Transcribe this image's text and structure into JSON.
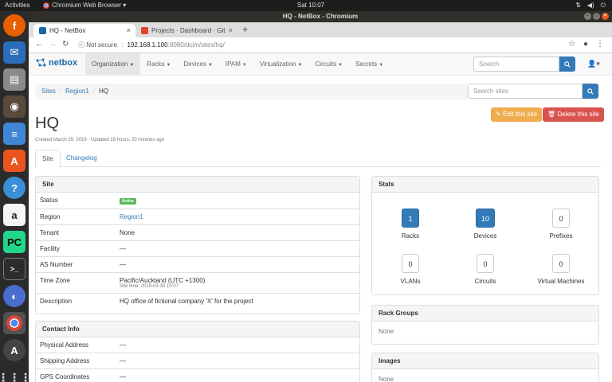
{
  "topbar": {
    "activities": "Activities",
    "app": "Chromium Web Browser ▾",
    "clock": "Sat 10:07"
  },
  "window": {
    "title": "HQ - NetBox - Chromium"
  },
  "browser": {
    "tabs": [
      {
        "label": "HQ - NetBox"
      },
      {
        "label": "Projects · Dashboard · Git"
      }
    ],
    "url_security": "Not secure",
    "url_host": "192.168.1.100",
    "url_path": ":8080/dcim/sites/hq/"
  },
  "navbar": {
    "brand": "netbox",
    "items": [
      {
        "label": "Organization"
      },
      {
        "label": "Racks"
      },
      {
        "label": "Devices"
      },
      {
        "label": "IPAM"
      },
      {
        "label": "Virtualization"
      },
      {
        "label": "Circuits"
      },
      {
        "label": "Secrets"
      }
    ],
    "search_placeholder": "Search"
  },
  "breadcrumb": {
    "items": [
      "Sites",
      "Region1",
      "HQ"
    ],
    "search_placeholder": "Search sites"
  },
  "actions": {
    "edit": "Edit this site",
    "delete": "Delete this site"
  },
  "page": {
    "title": "HQ",
    "meta": "Created March 29, 2019 · Updated 18 hours, 20 minutes ago"
  },
  "tabs": [
    "Site",
    "Changelog"
  ],
  "site_panel": {
    "title": "Site",
    "rows": [
      {
        "key": "Status",
        "value": "Active"
      },
      {
        "key": "Region",
        "value": "Region1"
      },
      {
        "key": "Tenant",
        "value": "None"
      },
      {
        "key": "Facility",
        "value": "—"
      },
      {
        "key": "AS Number",
        "value": "—"
      },
      {
        "key": "Time Zone",
        "value": "Pacific/Auckland (UTC +1300)",
        "sub": "Site time: 2019-03-30 10:07"
      },
      {
        "key": "Description",
        "value": "HQ office of fictional company 'X' for the project"
      }
    ]
  },
  "contact_panel": {
    "title": "Contact Info",
    "rows": [
      {
        "key": "Physical Address",
        "value": "—"
      },
      {
        "key": "Shipping Address",
        "value": "—"
      },
      {
        "key": "GPS Coordinates",
        "value": "—"
      }
    ]
  },
  "stats_panel": {
    "title": "Stats",
    "items": [
      {
        "value": "1",
        "label": "Racks"
      },
      {
        "value": "10",
        "label": "Devices"
      },
      {
        "value": "0",
        "label": "Prefixes"
      },
      {
        "value": "0",
        "label": "VLANs"
      },
      {
        "value": "0",
        "label": "Circuits"
      },
      {
        "value": "0",
        "label": "Virtual Machines"
      }
    ]
  },
  "rack_groups_panel": {
    "title": "Rack Groups",
    "body": "None"
  },
  "images_panel": {
    "title": "Images",
    "body": "None"
  }
}
